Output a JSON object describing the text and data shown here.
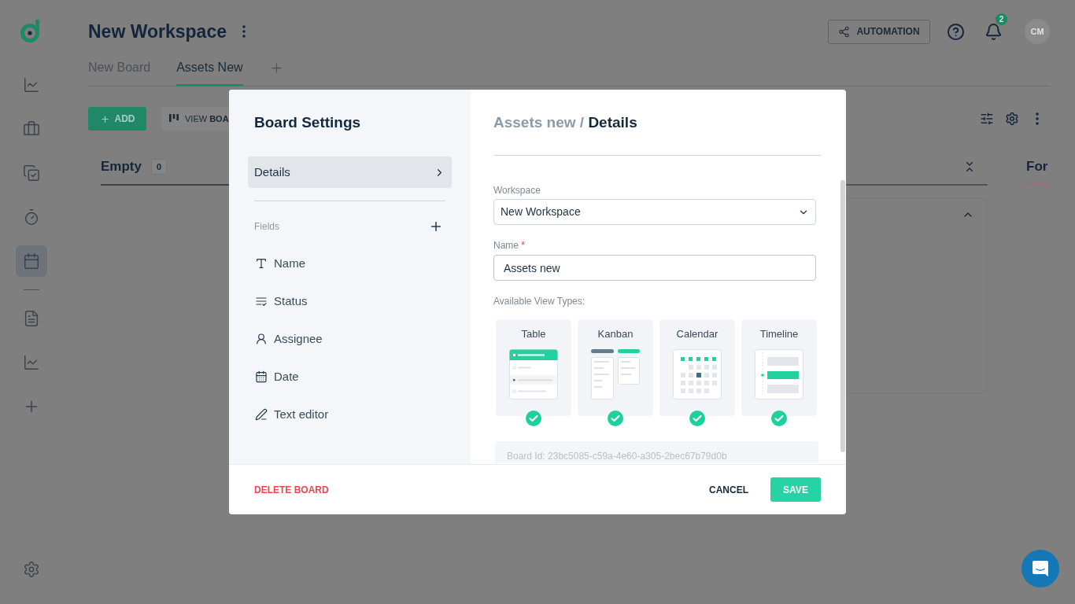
{
  "sidebar": {
    "items": [
      {
        "selected": false
      },
      {
        "selected": false
      },
      {
        "selected": false
      },
      {
        "selected": false
      },
      {
        "selected": true
      },
      {
        "selected": false
      },
      {
        "selected": false
      }
    ]
  },
  "header": {
    "title": "New Workspace",
    "automation_button": "AUTOMATION",
    "notification_count": "2",
    "avatar_initials": "CM"
  },
  "tabs": [
    {
      "label": "New Board",
      "selected": false
    },
    {
      "label": "Assets New",
      "selected": true
    }
  ],
  "toolbar": {
    "add_button": "ADD",
    "view_button": "VIEW **BOA**"
  },
  "board": {
    "columns": [
      {
        "title": "Empty",
        "count": "0"
      },
      {
        "title": "For"
      }
    ]
  },
  "modal": {
    "title": "Board Settings",
    "nav": [
      {
        "label": "Details",
        "selected": true
      }
    ],
    "fields_label": "Fields",
    "fields": [
      {
        "kind": "text",
        "label": "Name"
      },
      {
        "kind": "status",
        "label": "Status"
      },
      {
        "kind": "person",
        "label": "Assignee"
      },
      {
        "kind": "date",
        "label": "Date"
      },
      {
        "kind": "editor",
        "label": "Text editor"
      }
    ],
    "breadcrumb": {
      "parent": "Assets new /",
      "current": "Details"
    },
    "workspace": {
      "label": "Workspace",
      "value": "New Workspace"
    },
    "name": {
      "label": "Name",
      "required_mark": "*",
      "value": "Assets new"
    },
    "view_types_label": "Available View Types:",
    "view_types": [
      {
        "kind": "table",
        "label": "Table",
        "selected": true
      },
      {
        "kind": "kanban",
        "label": "Kanban",
        "selected": true
      },
      {
        "kind": "calendar",
        "label": "Calendar",
        "selected": true
      },
      {
        "kind": "timeline",
        "label": "Timeline",
        "selected": true
      }
    ],
    "board_id": "Board Id: 23bc5085-c59a-4e60-a305-2bec67b79d0b",
    "buttons": {
      "delete": "DELETE BOARD",
      "cancel": "CANCEL",
      "save": "SAVE"
    }
  }
}
